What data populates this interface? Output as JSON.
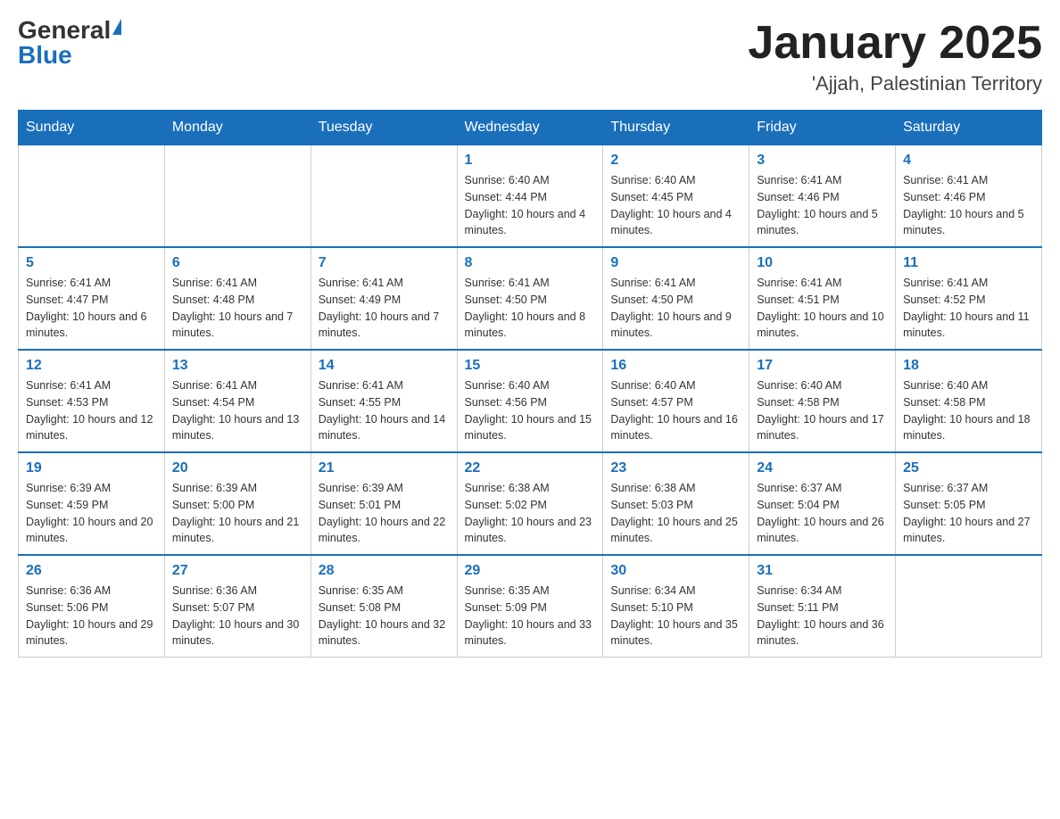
{
  "header": {
    "logo_general": "General",
    "logo_blue": "Blue",
    "month_title": "January 2025",
    "location": "'Ajjah, Palestinian Territory"
  },
  "days_of_week": [
    "Sunday",
    "Monday",
    "Tuesday",
    "Wednesday",
    "Thursday",
    "Friday",
    "Saturday"
  ],
  "weeks": [
    [
      {
        "day": "",
        "info": ""
      },
      {
        "day": "",
        "info": ""
      },
      {
        "day": "",
        "info": ""
      },
      {
        "day": "1",
        "info": "Sunrise: 6:40 AM\nSunset: 4:44 PM\nDaylight: 10 hours and 4 minutes."
      },
      {
        "day": "2",
        "info": "Sunrise: 6:40 AM\nSunset: 4:45 PM\nDaylight: 10 hours and 4 minutes."
      },
      {
        "day": "3",
        "info": "Sunrise: 6:41 AM\nSunset: 4:46 PM\nDaylight: 10 hours and 5 minutes."
      },
      {
        "day": "4",
        "info": "Sunrise: 6:41 AM\nSunset: 4:46 PM\nDaylight: 10 hours and 5 minutes."
      }
    ],
    [
      {
        "day": "5",
        "info": "Sunrise: 6:41 AM\nSunset: 4:47 PM\nDaylight: 10 hours and 6 minutes."
      },
      {
        "day": "6",
        "info": "Sunrise: 6:41 AM\nSunset: 4:48 PM\nDaylight: 10 hours and 7 minutes."
      },
      {
        "day": "7",
        "info": "Sunrise: 6:41 AM\nSunset: 4:49 PM\nDaylight: 10 hours and 7 minutes."
      },
      {
        "day": "8",
        "info": "Sunrise: 6:41 AM\nSunset: 4:50 PM\nDaylight: 10 hours and 8 minutes."
      },
      {
        "day": "9",
        "info": "Sunrise: 6:41 AM\nSunset: 4:50 PM\nDaylight: 10 hours and 9 minutes."
      },
      {
        "day": "10",
        "info": "Sunrise: 6:41 AM\nSunset: 4:51 PM\nDaylight: 10 hours and 10 minutes."
      },
      {
        "day": "11",
        "info": "Sunrise: 6:41 AM\nSunset: 4:52 PM\nDaylight: 10 hours and 11 minutes."
      }
    ],
    [
      {
        "day": "12",
        "info": "Sunrise: 6:41 AM\nSunset: 4:53 PM\nDaylight: 10 hours and 12 minutes."
      },
      {
        "day": "13",
        "info": "Sunrise: 6:41 AM\nSunset: 4:54 PM\nDaylight: 10 hours and 13 minutes."
      },
      {
        "day": "14",
        "info": "Sunrise: 6:41 AM\nSunset: 4:55 PM\nDaylight: 10 hours and 14 minutes."
      },
      {
        "day": "15",
        "info": "Sunrise: 6:40 AM\nSunset: 4:56 PM\nDaylight: 10 hours and 15 minutes."
      },
      {
        "day": "16",
        "info": "Sunrise: 6:40 AM\nSunset: 4:57 PM\nDaylight: 10 hours and 16 minutes."
      },
      {
        "day": "17",
        "info": "Sunrise: 6:40 AM\nSunset: 4:58 PM\nDaylight: 10 hours and 17 minutes."
      },
      {
        "day": "18",
        "info": "Sunrise: 6:40 AM\nSunset: 4:58 PM\nDaylight: 10 hours and 18 minutes."
      }
    ],
    [
      {
        "day": "19",
        "info": "Sunrise: 6:39 AM\nSunset: 4:59 PM\nDaylight: 10 hours and 20 minutes."
      },
      {
        "day": "20",
        "info": "Sunrise: 6:39 AM\nSunset: 5:00 PM\nDaylight: 10 hours and 21 minutes."
      },
      {
        "day": "21",
        "info": "Sunrise: 6:39 AM\nSunset: 5:01 PM\nDaylight: 10 hours and 22 minutes."
      },
      {
        "day": "22",
        "info": "Sunrise: 6:38 AM\nSunset: 5:02 PM\nDaylight: 10 hours and 23 minutes."
      },
      {
        "day": "23",
        "info": "Sunrise: 6:38 AM\nSunset: 5:03 PM\nDaylight: 10 hours and 25 minutes."
      },
      {
        "day": "24",
        "info": "Sunrise: 6:37 AM\nSunset: 5:04 PM\nDaylight: 10 hours and 26 minutes."
      },
      {
        "day": "25",
        "info": "Sunrise: 6:37 AM\nSunset: 5:05 PM\nDaylight: 10 hours and 27 minutes."
      }
    ],
    [
      {
        "day": "26",
        "info": "Sunrise: 6:36 AM\nSunset: 5:06 PM\nDaylight: 10 hours and 29 minutes."
      },
      {
        "day": "27",
        "info": "Sunrise: 6:36 AM\nSunset: 5:07 PM\nDaylight: 10 hours and 30 minutes."
      },
      {
        "day": "28",
        "info": "Sunrise: 6:35 AM\nSunset: 5:08 PM\nDaylight: 10 hours and 32 minutes."
      },
      {
        "day": "29",
        "info": "Sunrise: 6:35 AM\nSunset: 5:09 PM\nDaylight: 10 hours and 33 minutes."
      },
      {
        "day": "30",
        "info": "Sunrise: 6:34 AM\nSunset: 5:10 PM\nDaylight: 10 hours and 35 minutes."
      },
      {
        "day": "31",
        "info": "Sunrise: 6:34 AM\nSunset: 5:11 PM\nDaylight: 10 hours and 36 minutes."
      },
      {
        "day": "",
        "info": ""
      }
    ]
  ]
}
